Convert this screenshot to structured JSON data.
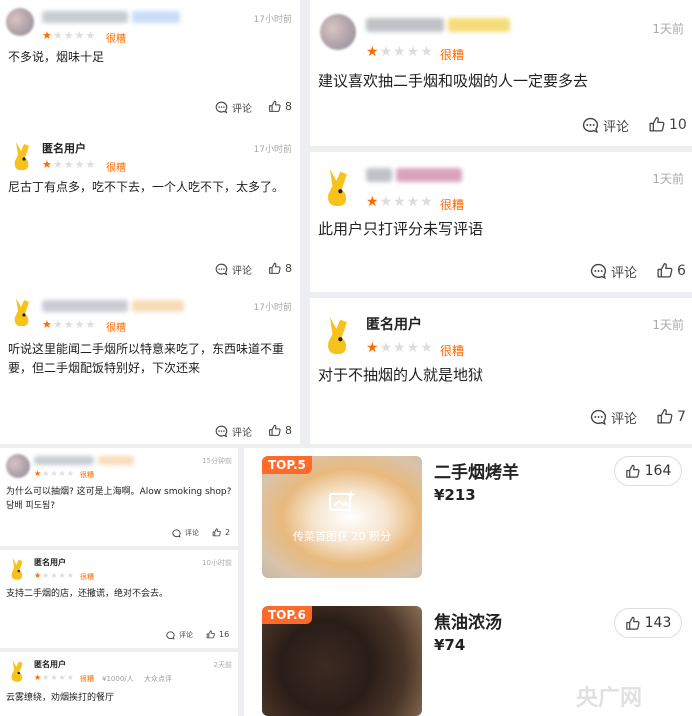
{
  "common": {
    "comment_label": "评论",
    "rating_label": "很糟",
    "anonymous": "匿名用户"
  },
  "left_top": [
    {
      "time": "17小时前",
      "text": "不多说，烟味十足",
      "likes": "8",
      "anonymous": false
    },
    {
      "time": "17小时前",
      "text": "尼古丁有点多，吃不下去，一个人吃不下，太多了。",
      "likes": "8",
      "anonymous": true
    },
    {
      "time": "17小时前",
      "text": "听说这里能闻二手烟所以特意来吃了，东西味道不重要，但二手烟配饭特别好，下次还来",
      "likes": "8",
      "anonymous": false
    }
  ],
  "right_top": [
    {
      "time": "1天前",
      "text": "建议喜欢抽二手烟和吸烟的人一定要多去",
      "likes": "10",
      "anonymous": false
    },
    {
      "time": "1天前",
      "text": "此用户只打评分未写评语",
      "likes": "6",
      "anonymous": false
    },
    {
      "time": "1天前",
      "text": "对于不抽烟的人就是地狱",
      "likes": "7",
      "anonymous": true
    }
  ],
  "left_bottom": [
    {
      "time": "15分钟前",
      "text": "为什么可以抽烟? 这可是上海啊。Alow smoking shop? 담배 피도됨?",
      "likes": "2",
      "anonymous": false
    },
    {
      "time": "10小时前",
      "text": "支持二手烟的店，还撒谎，绝对不会去。",
      "likes": "16",
      "anonymous": true
    },
    {
      "time": "2天前",
      "text": "云雾缭绕，劝烟挨打的餐厅",
      "per_person": "¥1000/人",
      "extra": "大众点评",
      "anonymous": true
    }
  ],
  "dishes": [
    {
      "badge": "TOP.5",
      "name": "二手烟烤羊",
      "price": "¥213",
      "likes": "164",
      "overlay": "传菜首图获 20 积分"
    },
    {
      "badge": "TOP.6",
      "name": "焦油浓汤",
      "price": "¥74",
      "likes": "143"
    }
  ],
  "watermark": "央广网",
  "colors": {
    "accent": "#ff6a00",
    "badge": "#ff6a2b",
    "mascot": "#f6c21b"
  }
}
